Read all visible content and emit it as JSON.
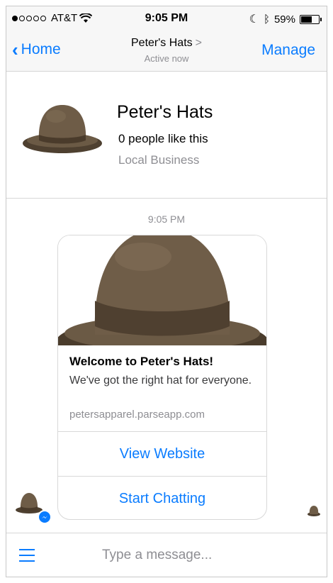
{
  "status_bar": {
    "carrier": "AT&T",
    "time": "9:05 PM",
    "battery": "59%",
    "battery_level": 0.59,
    "icons": [
      "signal-dots-icon",
      "wifi-icon",
      "moon-icon",
      "bluetooth-icon",
      "battery-icon"
    ]
  },
  "nav": {
    "back_label": "Home",
    "title": "Peter's Hats",
    "title_arrow": ">",
    "subtitle": "Active now",
    "manage_label": "Manage"
  },
  "profile": {
    "name": "Peter's Hats",
    "likes": "0 people like this",
    "category": "Local Business"
  },
  "conversation": {
    "timestamp": "9:05 PM",
    "card": {
      "title": "Welcome to Peter's Hats!",
      "subtitle": "We've got the right hat for everyone.",
      "url": "petersapparel.parseapp.com",
      "buttons": [
        "View Website",
        "Start Chatting"
      ]
    }
  },
  "composer": {
    "placeholder": "Type a message..."
  },
  "colors": {
    "accent": "#0a7cff",
    "hat_brown": "#6b5a45",
    "secondary_text": "#8e8e93"
  }
}
